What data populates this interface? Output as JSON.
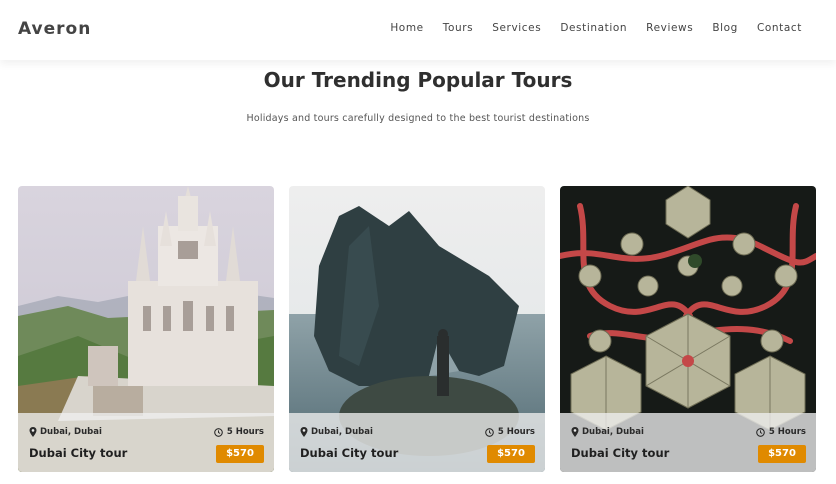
{
  "header": {
    "logo": "Averon",
    "nav": [
      "Home",
      "Tours",
      "Services",
      "Destination",
      "Reviews",
      "Blog",
      "Contact"
    ]
  },
  "section": {
    "title": "Our Trending Popular Tours",
    "subtitle": "Holidays and tours carefully designed to the best tourist destinations"
  },
  "tours": [
    {
      "location": "Dubai, Dubai",
      "duration": "5 Hours",
      "title": "Dubai City tour",
      "price": "$570",
      "image": "cathedral-on-hill-photo"
    },
    {
      "location": "Dubai, Dubai",
      "duration": "5 Hours",
      "title": "Dubai City tour",
      "price": "$570",
      "image": "sea-rock-arch-photo"
    },
    {
      "location": "Dubai, Dubai",
      "duration": "5 Hours",
      "title": "Dubai City tour",
      "price": "$570",
      "image": "aerial-structures-photo"
    }
  ],
  "icons": {
    "location": "map-pin-icon",
    "duration": "clock-icon"
  },
  "colors": {
    "accent": "#e08a00",
    "overlay": "#eeeeee",
    "text_dark": "#2f2f2f"
  }
}
